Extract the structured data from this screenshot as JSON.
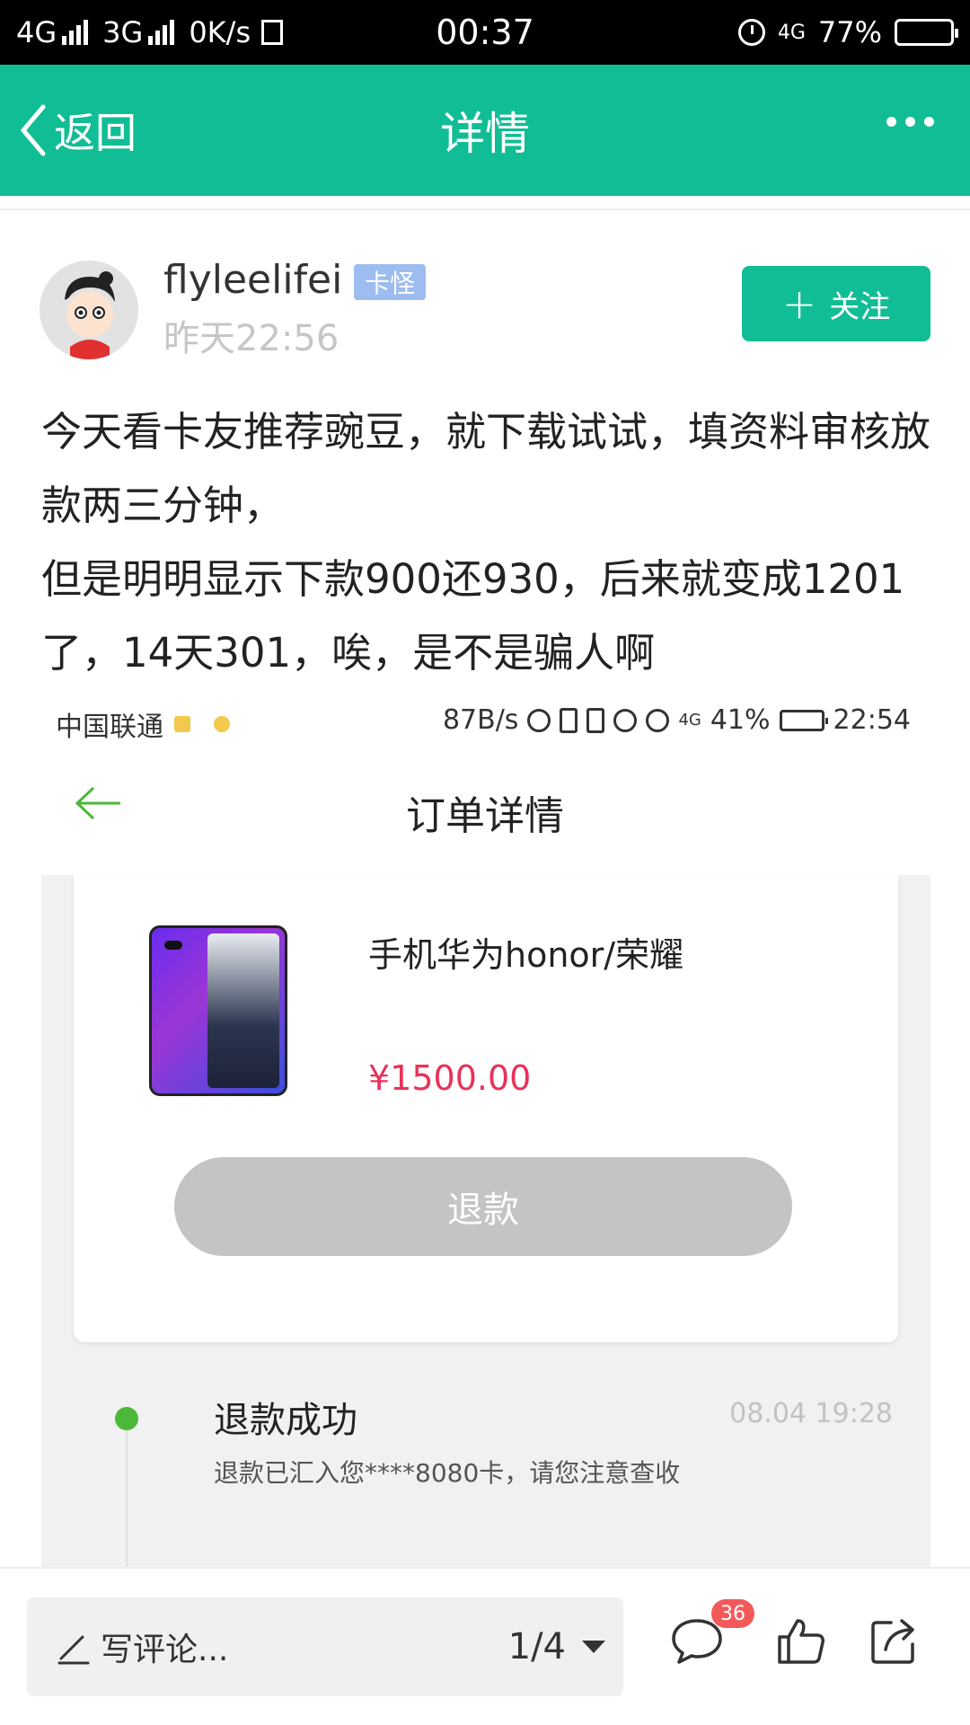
{
  "status_bar": {
    "network_left": "4G",
    "network_mid": "3G",
    "speed": "0K/s",
    "extra_icon": "sim-icon",
    "time": "00:37",
    "network_right": "4G",
    "battery_percent": "77%",
    "battery_level": 0.77
  },
  "header": {
    "back_label": "返回",
    "title": "详情",
    "more_icon": "more-dots-icon"
  },
  "post": {
    "username": "flyleelifei",
    "badge": "卡怪",
    "time": "昨天22:56",
    "follow_label": "关注",
    "follow_plus": "+",
    "text": "今天看卡友推荐豌豆，就下载试试，填资料审核放款两三分钟，\n但是明明显示下款900还930，后来就变成1201了，14天301，唉，是不是骗人啊"
  },
  "embedded": {
    "status": {
      "carrier": "中国联通",
      "speed": "87B/s",
      "signal_label": "4G",
      "battery": "41%",
      "time": "22:54"
    },
    "title": "订单详情",
    "product_name": "手机华为honor/荣耀",
    "price": "¥1500.00",
    "refund_button": "退款",
    "timeline": {
      "title": "退款成功",
      "time": "08.04 19:28",
      "desc": "退款已汇入您****8080卡，请您注意查收"
    }
  },
  "bottom": {
    "comment_placeholder": "写评论...",
    "pager": "1/4",
    "comment_count": "36",
    "icons": [
      "comment-icon",
      "like-icon",
      "share-icon"
    ]
  },
  "colors": {
    "brand": "#11bd95",
    "price": "#e8325a",
    "badge": "#9dbcf0",
    "success": "#4cb837",
    "count_badge": "#f25a5a"
  }
}
